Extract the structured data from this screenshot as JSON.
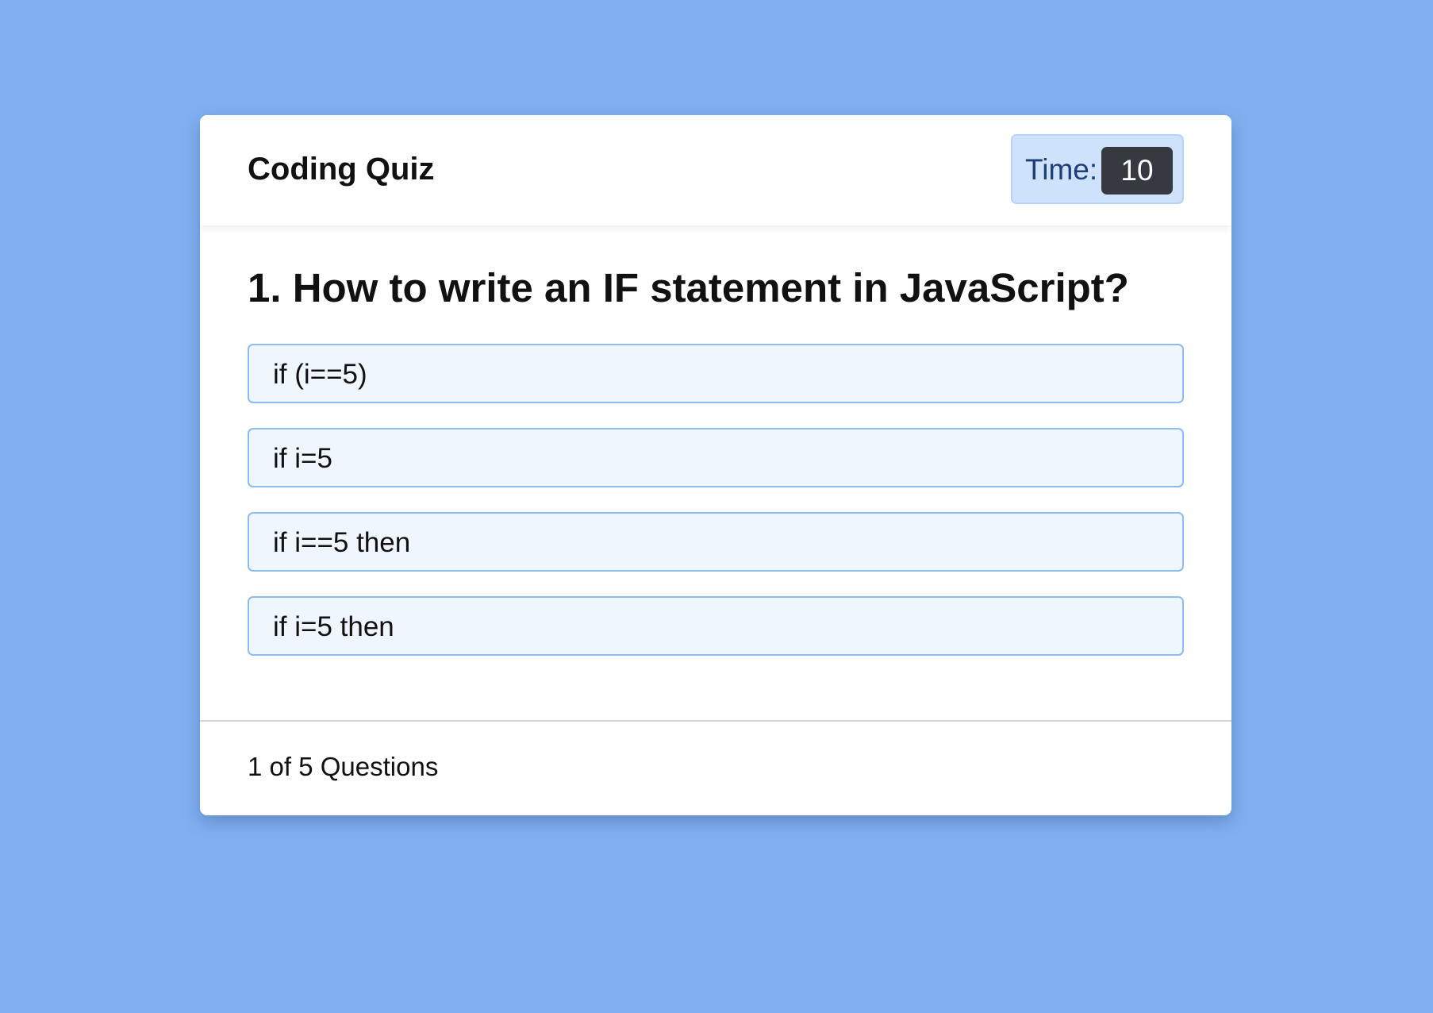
{
  "app": {
    "title": "Coding Quiz"
  },
  "timer": {
    "label": "Time:",
    "value": "10"
  },
  "question": {
    "text": "1. How to write an IF statement in JavaScript?",
    "answers": [
      {
        "label": "if (i==5)"
      },
      {
        "label": "if i=5"
      },
      {
        "label": "if i==5 then"
      },
      {
        "label": "if i=5 then"
      }
    ]
  },
  "footer": {
    "progress": "1 of 5 Questions"
  },
  "colors": {
    "background": "#80b0f0",
    "timer_background": "#cfe2fc",
    "timer_value_background": "#343a40",
    "answer_background": "#eff6fe",
    "answer_border": "#8ebcf0"
  }
}
